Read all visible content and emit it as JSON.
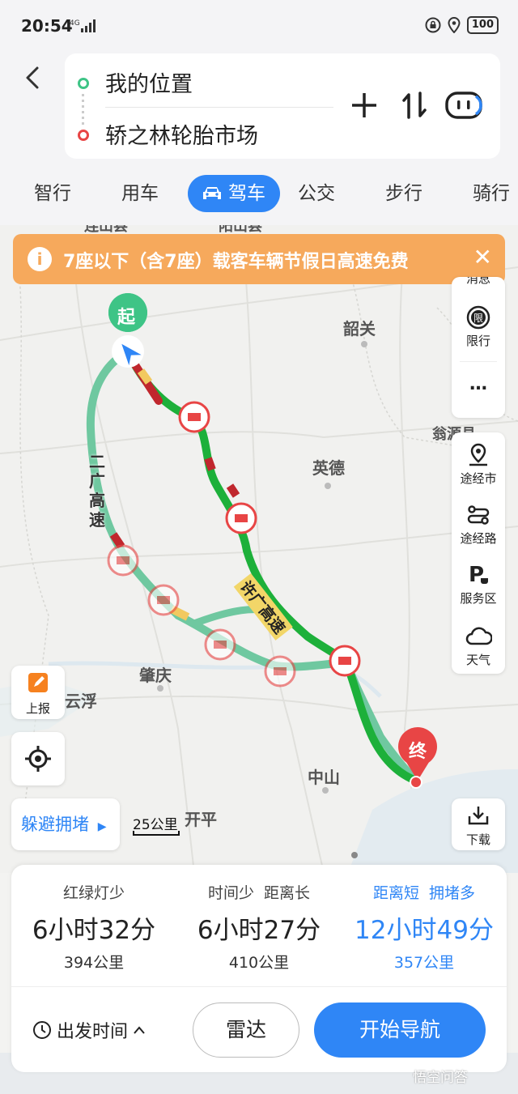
{
  "status_bar": {
    "time": "20:54",
    "network": "4G",
    "battery": "100"
  },
  "route": {
    "from": "我的位置",
    "to": "轿之林轮胎市场"
  },
  "modes": [
    "智行",
    "用车",
    "驾车",
    "公交",
    "步行",
    "骑行"
  ],
  "active_mode": "驾车",
  "notice": {
    "text": "7座以下（含7座）载客车辆节假日高速免费",
    "color": "#f6a95c"
  },
  "map": {
    "cities": [
      {
        "name": "韶关"
      },
      {
        "name": "英德"
      },
      {
        "name": "肇庆"
      },
      {
        "name": "云浮"
      },
      {
        "name": "中山"
      },
      {
        "name": "开平"
      }
    ],
    "highway_labels": {
      "left": "二广高速",
      "right": "许广高速"
    },
    "start_label": "起",
    "end_label": "终",
    "partial_labels": {
      "ruyuan": "翁源县",
      "top_left": "连山县",
      "top_mid": "阳山县"
    }
  },
  "side_tools": {
    "partial_top": "消息",
    "items": [
      {
        "label": "限行",
        "icon": "restriction-icon"
      },
      {
        "label": "…",
        "icon": "more-icon"
      }
    ],
    "route_tools": [
      {
        "label": "途经市",
        "icon": "via-city-icon"
      },
      {
        "label": "途经路",
        "icon": "via-road-icon"
      },
      {
        "label": "服务区",
        "icon": "service-area-icon"
      },
      {
        "label": "天气",
        "icon": "weather-icon"
      }
    ],
    "download": "下载"
  },
  "left_tools": {
    "report": "上报",
    "avoid": "躲避拥堵",
    "scale": "25公里"
  },
  "options": [
    {
      "tags": "红绿灯少",
      "time": "6小时32分",
      "distance": "394公里"
    },
    {
      "tags": "时间少  距离长",
      "time": "6小时27分",
      "distance": "410公里"
    },
    {
      "tags": "距离短  拥堵多",
      "time": "12小时49分",
      "distance": "357公里"
    }
  ],
  "actions": {
    "depart": "出发时间",
    "radar": "雷达",
    "navigate": "开始导航"
  },
  "watermark": "悟空问答",
  "colors": {
    "accent": "#2f86f6",
    "route_green": "#1db03a",
    "route_alt": "#6fc8a0",
    "congestion_red": "#c0272d"
  }
}
